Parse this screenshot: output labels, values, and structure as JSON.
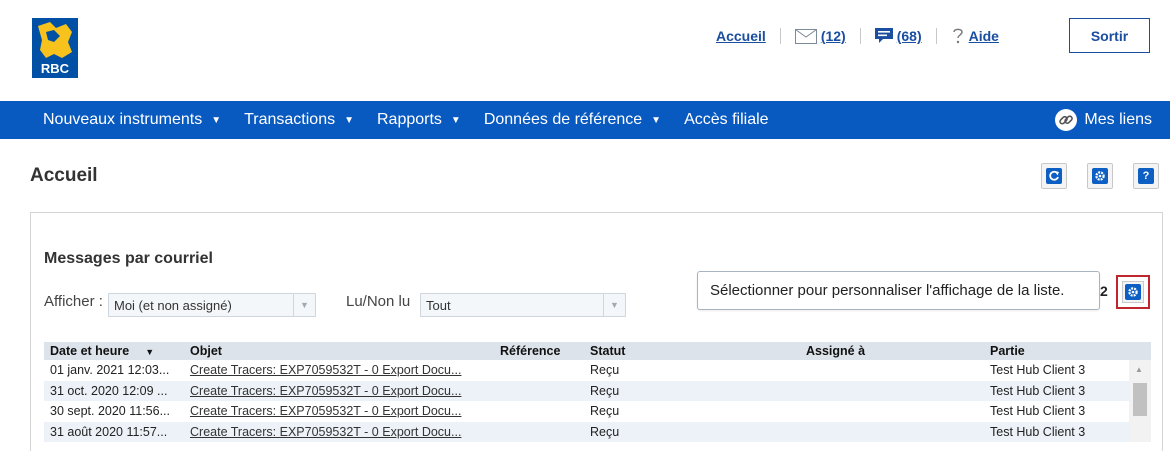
{
  "brand": {
    "name": "RBC",
    "accent": "#0859c0",
    "logo_gold": "#f7c21b",
    "logo_blue": "#0051a5"
  },
  "header": {
    "home_link": "Accueil",
    "mail_count": "(12)",
    "messages_count": "(68)",
    "help_link": "Aide",
    "exit_button": "Sortir",
    "icons": [
      "envelope-icon",
      "chat-bubble-icon",
      "question-icon"
    ]
  },
  "nav": {
    "items": [
      {
        "label": "Nouveaux instruments",
        "has_dropdown": true
      },
      {
        "label": "Transactions",
        "has_dropdown": true
      },
      {
        "label": "Rapports",
        "has_dropdown": true
      },
      {
        "label": "Données de référence",
        "has_dropdown": true
      },
      {
        "label": "Accès filiale",
        "has_dropdown": false
      }
    ],
    "my_links": "Mes liens"
  },
  "page": {
    "title": "Accueil",
    "toolbar_icons": [
      "refresh-icon",
      "settings-icon",
      "help-icon"
    ],
    "help_glyph": "?"
  },
  "panel": {
    "title": "Messages par courriel",
    "show_label": "Afficher :",
    "show_value": "Moi (et non assigné)",
    "read_label": "Lu/Non lu",
    "read_value": "Tout",
    "tooltip": "Sélectionner pour personnaliser l'affichage de la liste.",
    "count": "2"
  },
  "table": {
    "headers": [
      "Date et heure",
      "Objet",
      "Référence",
      "Statut",
      "Assigné à",
      "Partie"
    ],
    "rows": [
      {
        "date": "01 janv. 2021 12:03...",
        "subject": "Create Tracers: EXP7059532T - 0 Export Docu...",
        "reference": "",
        "status": "Reçu",
        "assigned": "",
        "party": "Test Hub Client 3"
      },
      {
        "date": "31 oct. 2020 12:09 ...",
        "subject": "Create Tracers: EXP7059532T - 0 Export Docu...",
        "reference": "",
        "status": "Reçu",
        "assigned": "",
        "party": "Test Hub Client 3"
      },
      {
        "date": "30 sept. 2020 11:56...",
        "subject": "Create Tracers: EXP7059532T - 0 Export Docu...",
        "reference": "",
        "status": "Reçu",
        "assigned": "",
        "party": "Test Hub Client 3"
      },
      {
        "date": "31 août 2020 11:57...",
        "subject": "Create Tracers: EXP7059532T - 0 Export Docu...",
        "reference": "",
        "status": "Reçu",
        "assigned": "",
        "party": "Test Hub Client 3"
      }
    ]
  }
}
